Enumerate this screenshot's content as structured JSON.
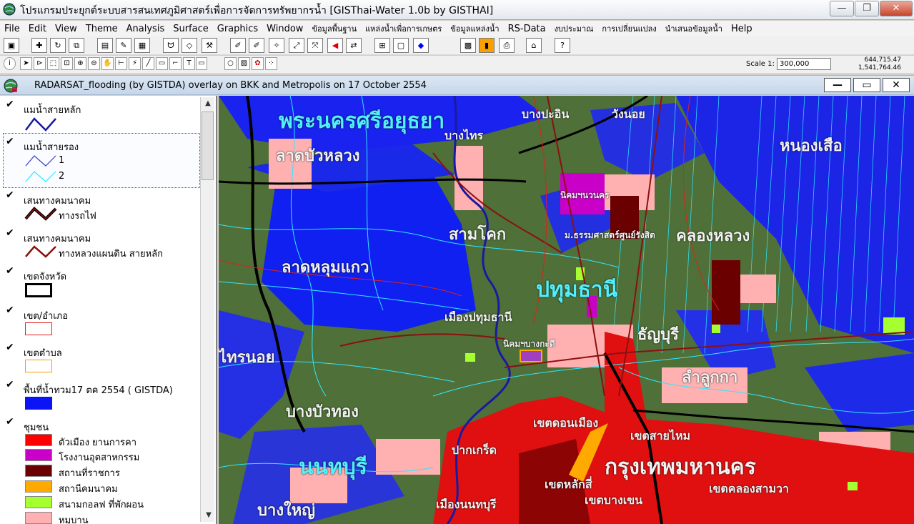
{
  "window": {
    "title": "โปรแกรมประยุกต์ระบบสารสนเทศภูมิศาสตร์เพื่อการจัดการทรัพยากรน้ำ  [GISThai-Water 1.0b   by GISTHAI]",
    "min": "—",
    "max": "❐",
    "close": "✕"
  },
  "menu": {
    "items": [
      "File",
      "Edit",
      "View",
      "Theme",
      "Analysis",
      "Surface",
      "Graphics",
      "Window"
    ],
    "thai_items": [
      "ข้อมูลพื้นฐาน",
      "แหล่งน้ำเพื่อการเกษตร",
      "ข้อมูลแหล่งน้ำ"
    ],
    "rs": "RS-Data",
    "thai_items2": [
      "งบประมาณ",
      "การเปลี่ยนแปลง",
      "นำเสนอข้อมูลน้ำ"
    ],
    "help": "Help"
  },
  "toolbar": {
    "scale_label": "Scale 1:",
    "scale_value": "300,000",
    "coord_x": "644,715.47",
    "coord_y": "1,541,764.46"
  },
  "doc": {
    "title": "RADARSAT_flooding (by GISTDA) overlay on BKK and Metropolis on 17 October 2554",
    "min": "—",
    "max": "▭",
    "close": "✕"
  },
  "legend": {
    "themes": [
      {
        "title": "แมน้ำสายหลัก",
        "items": []
      },
      {
        "title": "แมน้ำสายรอง",
        "items": [
          "1",
          "2"
        ]
      },
      {
        "title": "เสนทางคมนาคม",
        "items": [
          "ทางรถไฟ"
        ]
      },
      {
        "title": "เสนทางคมนาคม",
        "items": [
          "ทางหลวงแผนดิน สายหลัก"
        ]
      },
      {
        "title": "เขตจังหวัด",
        "items": []
      },
      {
        "title": "เขต/อำเภอ",
        "items": []
      },
      {
        "title": "เขตตำบล",
        "items": []
      },
      {
        "title": "พื้นที่น้ำทวม17 ตค 2554  ( GISTDA)",
        "items": []
      },
      {
        "title": "ชุมชน",
        "items": [
          "ตัวเมือง ยานการคา",
          "โรงงานอุตสาหกรรม",
          "สถานที่ราชการ",
          "สถานีคมนาคม",
          "สนามกอลฟ ที่พักผอน",
          "หมูบาน"
        ]
      }
    ],
    "colors": {
      "main_river": "#1a1aa0",
      "minor_river_1": "#3b3bd0",
      "minor_river_2": "#2ee8ff",
      "railway": "#000000",
      "highway": "#8b1010",
      "flood": "#0a14f5",
      "town": "#ff0000",
      "factory": "#c800c8",
      "govt": "#6a0000",
      "transport": "#ffaa00",
      "golf": "#a6ff2e",
      "village": "#ffb0b0"
    }
  },
  "map": {
    "places": [
      "พระนครศรีอยุธยา",
      "บางปะอิน",
      "วังนอย",
      "บางไทร",
      "ลาดบัวหลวง",
      "หนองเสือ",
      "นิคมฯนวนคร",
      "สามโคก",
      "ม.ธรรมศาสตร์ศูนย์รังสิต",
      "คลองหลวง",
      "ลาดหลุมแกว",
      "ปทุมธานี",
      "เมืองปทุมธานี",
      "ธัญบุรี",
      "ไทรนอย",
      "ลำลูกกา",
      "นิคมฯบางกะดี",
      "บางบัวทอง",
      "เขตดอนเมือง",
      "เขตสายไหม",
      "ปากเกร็ด",
      "นนทบุรี",
      "กรุงเทพมหานคร",
      "เขตหลักสี่",
      "เขตคลองสามวา",
      "บางใหญ่",
      "เมืองนนทบุรี",
      "เขตบางเขน"
    ]
  }
}
